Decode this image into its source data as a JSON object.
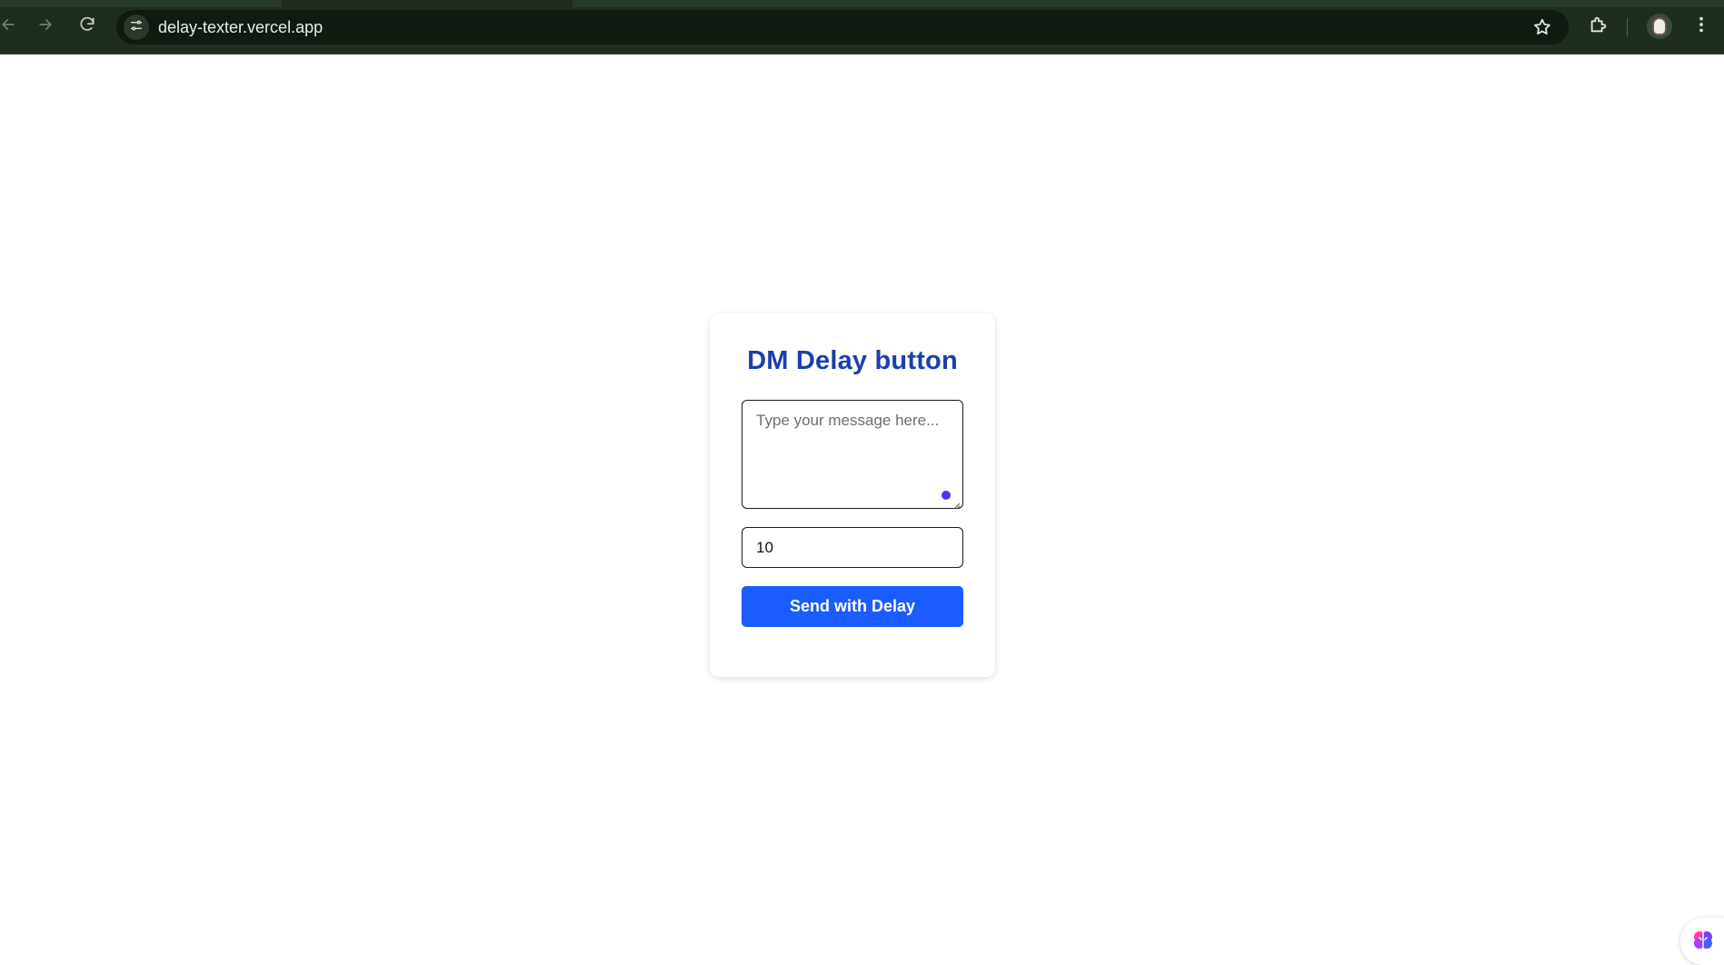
{
  "browser": {
    "url": "delay-texter.vercel.app",
    "icons": {
      "back": "arrow-left-icon",
      "forward": "arrow-right-icon",
      "reload": "reload-icon",
      "site_info": "tune-icon",
      "bookmark": "star-icon",
      "extensions": "puzzle-icon",
      "profile": "avatar",
      "menu": "more-vert-icon"
    },
    "chrome_color": "#1f2d1f"
  },
  "app": {
    "title": "DM Delay button",
    "message_placeholder": "Type your message here...",
    "message_value": "",
    "delay_value": "10",
    "send_label": "Send with Delay",
    "colors": {
      "title": "#1a3fae",
      "button": "#1a5cff",
      "button_text": "#ffffff"
    }
  },
  "widget": {
    "icon": "brain-icon"
  }
}
